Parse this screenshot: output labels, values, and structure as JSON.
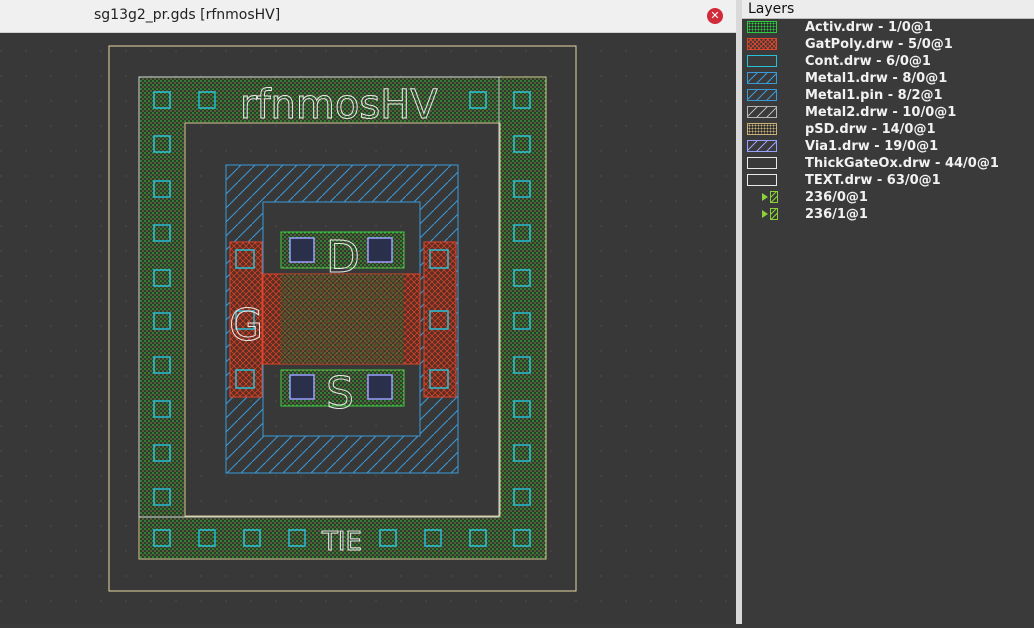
{
  "window": {
    "title": "sg13g2_pr.gds [rfnmosHV]"
  },
  "layout": {
    "labels": {
      "cell": "rfnmosHV",
      "drain": "D",
      "gate": "G",
      "source": "S",
      "tie": "TIE"
    }
  },
  "layers_panel": {
    "header": "Layers",
    "items": [
      {
        "label": "Activ.drw - 1/0@1",
        "color": "#2ecc40",
        "pattern": "dots"
      },
      {
        "label": "GatPoly.drw - 5/0@1",
        "color": "#e0442a",
        "pattern": "cross"
      },
      {
        "label": "Cont.drw - 6/0@1",
        "color": "#27c0d8",
        "pattern": "empty"
      },
      {
        "label": "Metal1.drw - 8/0@1",
        "color": "#3a9ad9",
        "pattern": "diag"
      },
      {
        "label": "Metal1.pin - 8/2@1",
        "color": "#3a9ad9",
        "pattern": "diag"
      },
      {
        "label": "Metal2.drw - 10/0@1",
        "color": "#b5b5b5",
        "pattern": "diag"
      },
      {
        "label": "pSD.drw - 14/0@1",
        "color": "#c8b27a",
        "pattern": "dots"
      },
      {
        "label": "Via1.drw - 19/0@1",
        "color": "#9aa0ff",
        "pattern": "diag"
      },
      {
        "label": "ThickGateOx.drw - 44/0@1",
        "color": "#e8e8e8",
        "pattern": "empty"
      },
      {
        "label": "TEXT.drw - 63/0@1",
        "color": "#e8e8e8",
        "pattern": "empty"
      },
      {
        "label": "236/0@1",
        "color": "#8ad13c",
        "pattern": "group"
      },
      {
        "label": "236/1@1",
        "color": "#8ad13c",
        "pattern": "group"
      }
    ]
  }
}
